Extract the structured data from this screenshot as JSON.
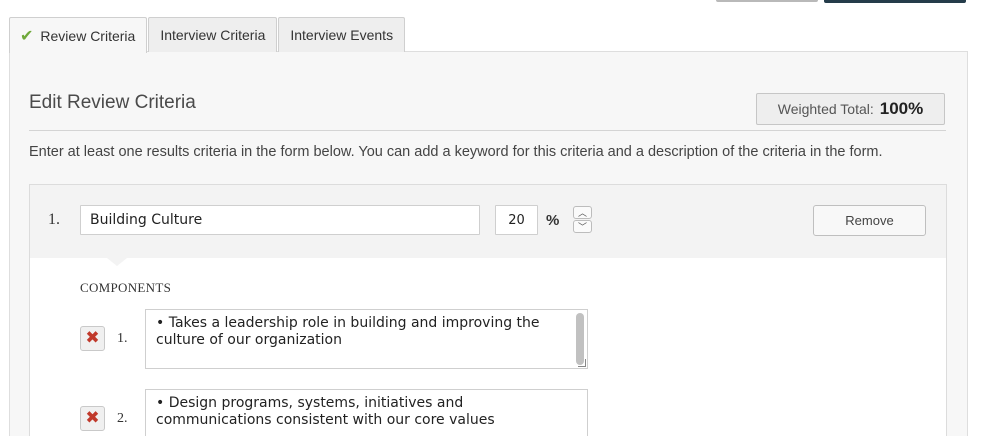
{
  "tabs": [
    {
      "label": "Review Criteria",
      "active": true,
      "completed": true
    },
    {
      "label": "Interview Criteria",
      "active": false
    },
    {
      "label": "Interview Events",
      "active": false
    }
  ],
  "page": {
    "heading": "Edit Review Criteria",
    "weighted_total_label": "Weighted Total:",
    "weighted_total_value": "100%",
    "instructions": "Enter at least one results criteria in the form below. You can add a keyword for this criteria and a description of the criteria in the form."
  },
  "criteria": [
    {
      "number": "1.",
      "name": "Building Culture",
      "percent": "20",
      "percent_sign": "%",
      "remove_label": "Remove",
      "components_label": "COMPONENTS",
      "components": [
        {
          "number": "1.",
          "text": "• Takes a leadership role in building and improving the culture of our organization"
        },
        {
          "number": "2.",
          "text": "• Design programs, systems, initiatives and communications consistent with our core values"
        }
      ]
    }
  ],
  "icons": {
    "tab_complete": "check-icon",
    "delete_component": "x-icon",
    "spinner_up": "chevron-up-icon",
    "spinner_down": "chevron-down-icon"
  },
  "colors": {
    "check": "#6fa83a",
    "delete_x": "#c0392b",
    "panel_bg": "#f7f7f7"
  }
}
